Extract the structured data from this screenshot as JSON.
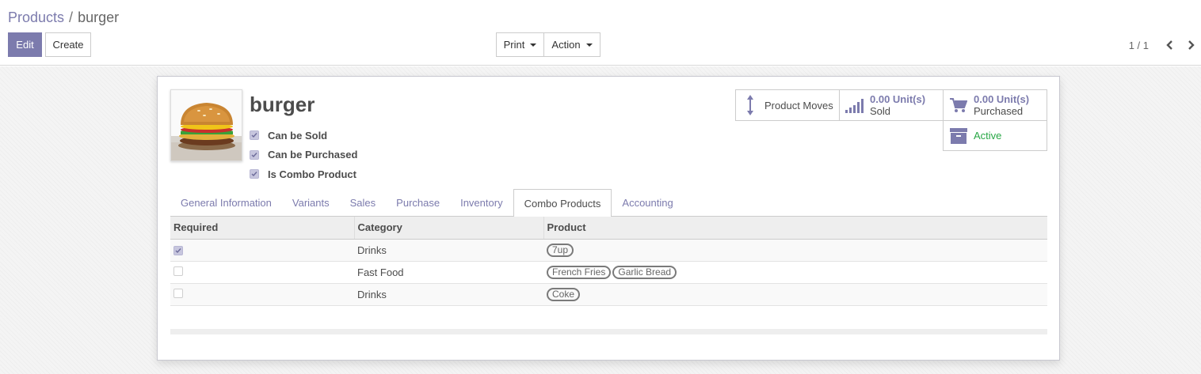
{
  "breadcrumb": {
    "parent": "Products",
    "separator": "/",
    "current": "burger"
  },
  "toolbar": {
    "edit_label": "Edit",
    "create_label": "Create",
    "print_label": "Print",
    "action_label": "Action"
  },
  "pager": {
    "value": "1 / 1"
  },
  "product": {
    "name": "burger",
    "image_icon": "burger-photo",
    "flags": [
      {
        "label": "Can be Sold",
        "checked": true
      },
      {
        "label": "Can be Purchased",
        "checked": true
      },
      {
        "label": "Is Combo Product",
        "checked": true
      }
    ]
  },
  "stat_buttons": {
    "moves": {
      "label": "Product Moves",
      "icon": "arrows-v-icon"
    },
    "sold": {
      "value": "0.00 Unit(s)",
      "label": "Sold",
      "icon": "signal-icon"
    },
    "purchased": {
      "value": "0.00 Unit(s)",
      "label": "Purchased",
      "icon": "cart-icon"
    },
    "active": {
      "label": "Active",
      "icon": "archive-icon"
    }
  },
  "tabs": [
    {
      "label": "General Information",
      "active": false
    },
    {
      "label": "Variants",
      "active": false
    },
    {
      "label": "Sales",
      "active": false
    },
    {
      "label": "Purchase",
      "active": false
    },
    {
      "label": "Inventory",
      "active": false
    },
    {
      "label": "Combo Products",
      "active": true
    },
    {
      "label": "Accounting",
      "active": false
    }
  ],
  "table": {
    "headers": [
      "Required",
      "Category",
      "Product"
    ],
    "rows": [
      {
        "required": true,
        "category": "Drinks",
        "products": [
          "7up"
        ]
      },
      {
        "required": false,
        "category": "Fast Food",
        "products": [
          "French Fries",
          "Garlic Bread"
        ]
      },
      {
        "required": false,
        "category": "Drinks",
        "products": [
          "Coke"
        ]
      }
    ]
  },
  "colors": {
    "brand": "#7c7bad",
    "active": "#28a745",
    "text": "#4c4c4c"
  }
}
